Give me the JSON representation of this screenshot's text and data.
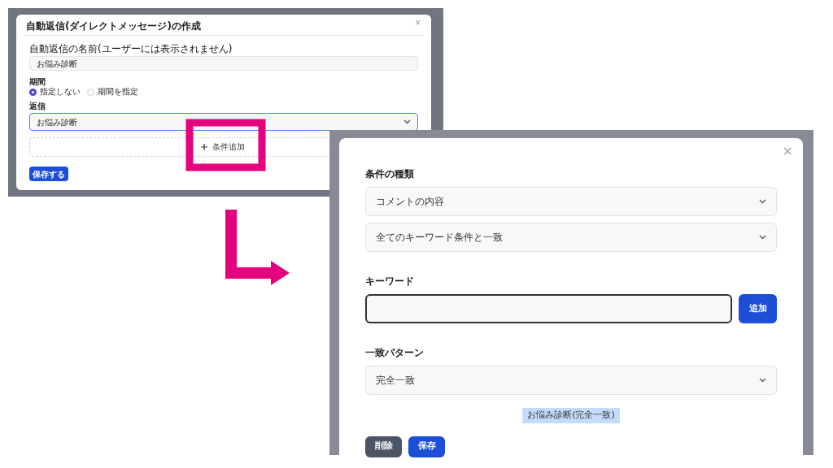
{
  "left_dialog": {
    "title": "自動返信(ダイレクトメッセージ)の作成",
    "close": "×",
    "name_field": {
      "label": "自動返信の名前(ユーザーには表示されません)",
      "value": "お悩み診断"
    },
    "period": {
      "label": "期間",
      "options": [
        {
          "label": "指定しない",
          "selected": true
        },
        {
          "label": "期間を指定",
          "selected": false
        }
      ]
    },
    "reply": {
      "label": "返信",
      "value": "お悩み診断"
    },
    "add_condition": "条件追加",
    "save_button": "保存する"
  },
  "right_dialog": {
    "close": "×",
    "type_label": "条件の種類",
    "selects": [
      "コメントの内容",
      "全てのキーワード条件と一致"
    ],
    "keyword_label": "キーワード",
    "add_button": "追加",
    "pattern_label": "一致パターン",
    "pattern": "完全一致",
    "tag": "お悩み診断(完全一致)",
    "delete_button": "削除",
    "save_button": "保存"
  }
}
